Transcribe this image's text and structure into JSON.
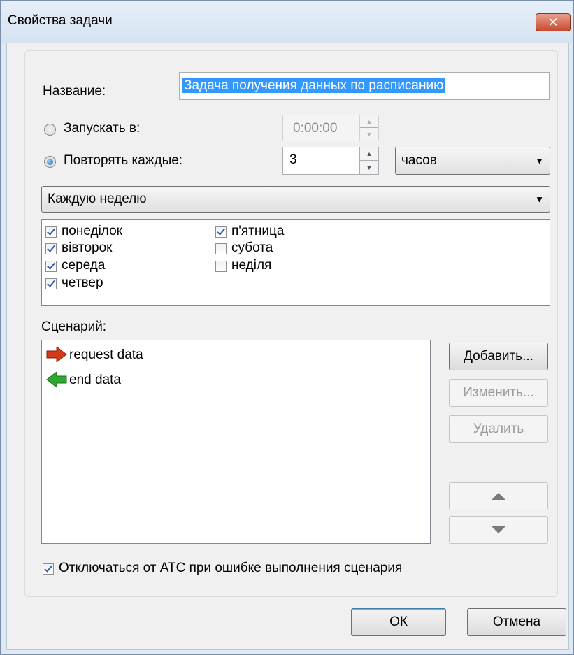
{
  "window": {
    "title": "Свойства задачи",
    "close_glyph": "✕"
  },
  "form": {
    "name_label": "Название:",
    "name_value": "Задача получения данных по расписанию",
    "run_at_label": "Запускать в:",
    "run_at_value": "0:00:00",
    "repeat_label": "Повторять каждые:",
    "repeat_value": "3",
    "repeat_unit": "часов",
    "schedule_mode": "Каждую неделю",
    "selected_radio": "repeat"
  },
  "days": [
    {
      "label": "понеділок",
      "checked": true
    },
    {
      "label": "вівторок",
      "checked": true
    },
    {
      "label": "середа",
      "checked": true
    },
    {
      "label": "четвер",
      "checked": true
    },
    {
      "label": "п'ятница",
      "checked": true
    },
    {
      "label": "субота",
      "checked": false
    },
    {
      "label": "неділя",
      "checked": false
    }
  ],
  "scenario": {
    "label": "Сценарий:",
    "items": [
      {
        "text": "request data",
        "icon": "red-arrow-right-icon",
        "color": "#d43a1a"
      },
      {
        "text": "end data",
        "icon": "green-arrow-left-icon",
        "color": "#2ea82e"
      }
    ],
    "add_button": "Добавить...",
    "edit_button": "Изменить...",
    "delete_button": "Удалить",
    "up_icon": "arrow-up-icon",
    "down_icon": "arrow-down-icon"
  },
  "disconnect_on_error": {
    "label": "Отключаться от АТС при ошибке выполнения сценария",
    "checked": true
  },
  "footer": {
    "ok_button": "ОК",
    "cancel_button": "Отмена"
  }
}
